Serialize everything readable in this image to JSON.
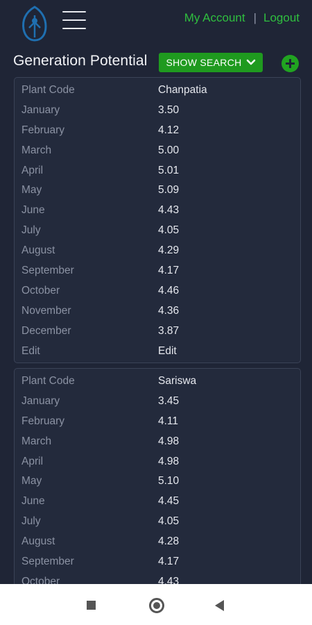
{
  "header": {
    "my_account": "My Account",
    "separator": "|",
    "logout": "Logout",
    "logo_icon": "leaf-logo-icon",
    "menu_icon": "hamburger-menu-icon"
  },
  "page": {
    "title": "Generation Potential",
    "show_search_label": "SHOW SEARCH",
    "show_search_icon": "chevron-down-icon",
    "add_icon": "plus-circle-icon",
    "accent_color": "#1f9a1f"
  },
  "cards": [
    {
      "rows": [
        {
          "label": "Plant Code",
          "value": "Chanpatia"
        },
        {
          "label": "January",
          "value": "3.50"
        },
        {
          "label": "February",
          "value": "4.12"
        },
        {
          "label": "March",
          "value": "5.00"
        },
        {
          "label": "April",
          "value": "5.01"
        },
        {
          "label": "May",
          "value": "5.09"
        },
        {
          "label": "June",
          "value": "4.43"
        },
        {
          "label": "July",
          "value": "4.05"
        },
        {
          "label": "August",
          "value": "4.29"
        },
        {
          "label": "September",
          "value": "4.17"
        },
        {
          "label": "October",
          "value": "4.46"
        },
        {
          "label": "November",
          "value": "4.36"
        },
        {
          "label": "December",
          "value": "3.87"
        },
        {
          "label": "Edit",
          "value": "Edit"
        }
      ]
    },
    {
      "rows": [
        {
          "label": "Plant Code",
          "value": "Sariswa"
        },
        {
          "label": "January",
          "value": "3.45"
        },
        {
          "label": "February",
          "value": "4.11"
        },
        {
          "label": "March",
          "value": "4.98"
        },
        {
          "label": "April",
          "value": "4.98"
        },
        {
          "label": "May",
          "value": "5.10"
        },
        {
          "label": "June",
          "value": "4.45"
        },
        {
          "label": "July",
          "value": "4.05"
        },
        {
          "label": "August",
          "value": "4.28"
        },
        {
          "label": "September",
          "value": "4.17"
        },
        {
          "label": "October",
          "value": "4.43"
        }
      ]
    }
  ],
  "android_nav": {
    "recents_icon": "square-recents-icon",
    "home_icon": "circle-home-icon",
    "back_icon": "triangle-back-icon"
  }
}
